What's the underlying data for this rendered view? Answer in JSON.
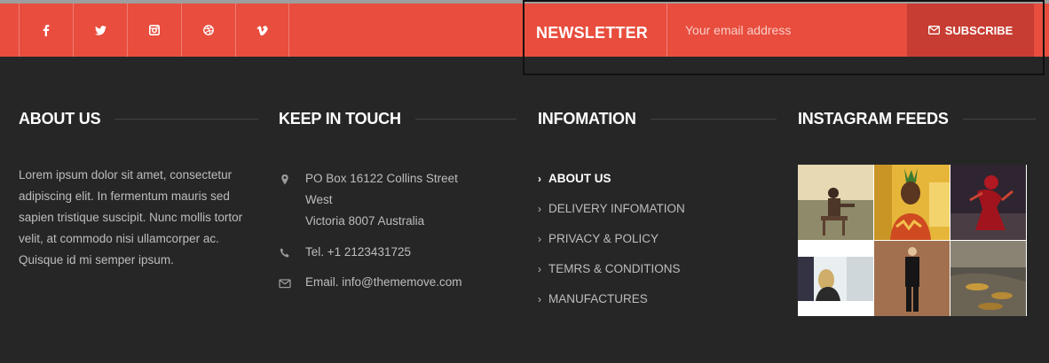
{
  "topbar": {
    "social": [
      {
        "name": "facebook-icon",
        "glyph": "f"
      },
      {
        "name": "twitter-icon",
        "glyph": "t"
      },
      {
        "name": "instagram-icon",
        "glyph": "i"
      },
      {
        "name": "dribbble-icon",
        "glyph": "d"
      },
      {
        "name": "vimeo-icon",
        "glyph": "v"
      }
    ],
    "newsletter": {
      "title": "NEWSLETTER",
      "placeholder": "Your email address",
      "button_label": "SUBSCRIBE",
      "button_icon": "envelope-icon"
    }
  },
  "footer": {
    "about": {
      "title": "ABOUT US",
      "text": "Lorem ipsum dolor sit amet, consectetur adipiscing elit. In fermentum mauris sed sapien tristique suscipit. Nunc mollis tortor velit, at commodo nisi ullamcorper ac. Quisque id mi semper ipsum."
    },
    "contact": {
      "title": "KEEP IN TOUCH",
      "address_line1": "PO Box 16122 Collins Street",
      "address_line2": "West",
      "address_line3": "Victoria 8007 Australia",
      "phone": "Tel. +1 2123431725",
      "email": "Email. info@thememove.com"
    },
    "info": {
      "title": "INFOMATION",
      "links": [
        "ABOUT US",
        "DELIVERY INFOMATION",
        "PRIVACY & POLICY",
        "TEMRS & CONDITIONS",
        "MANUFACTURES"
      ]
    },
    "instagram": {
      "title": "INSTAGRAM FEEDS"
    }
  },
  "colors": {
    "accent": "#e84d3d",
    "accent_dark": "#c73d33",
    "background": "#262626"
  }
}
